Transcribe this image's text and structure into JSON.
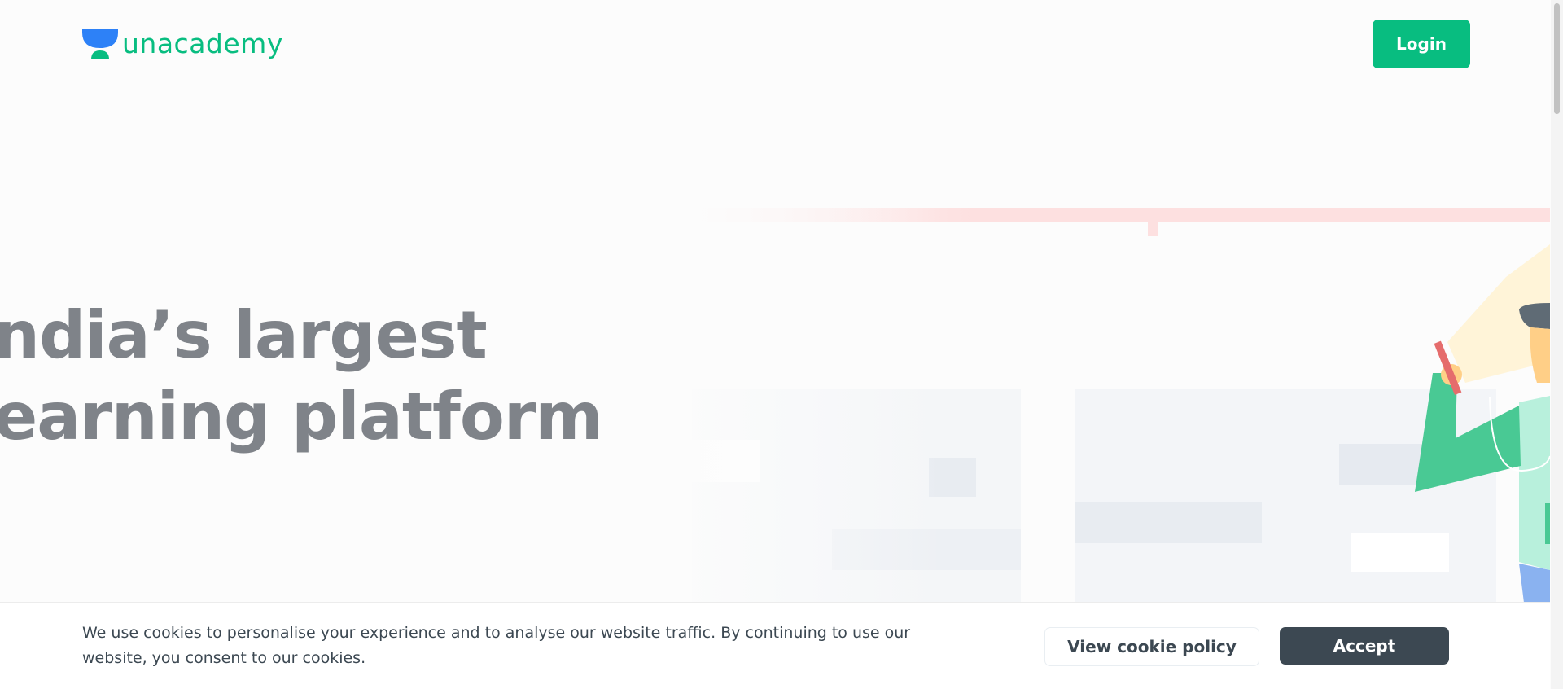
{
  "header": {
    "logo_text": "unacademy",
    "login_label": "Login"
  },
  "hero": {
    "title_line_1": "ndia’s largest",
    "title_line_2": "earning platform"
  },
  "cookie_banner": {
    "message": "We use cookies to personalise your experience and to analyse our website traffic. By continuing to use our website, you consent to our cookies.",
    "policy_label": "View cookie policy",
    "accept_label": "Accept"
  },
  "colors": {
    "brand_green": "#08bd80",
    "brand_blue": "#2d81f7",
    "hero_text": "#7f8389",
    "dark_button": "#3c4852"
  },
  "icons": {
    "logo": "unacademy-logo-icon"
  }
}
